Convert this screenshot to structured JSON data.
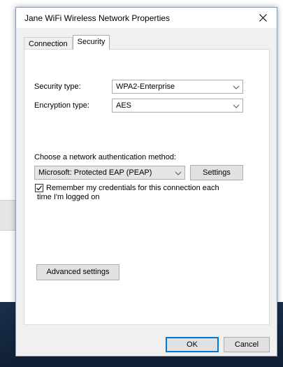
{
  "dialog": {
    "title": "Jane WiFi Wireless Network Properties",
    "close_icon": "close-icon"
  },
  "tabs": [
    {
      "label": "Connection",
      "active": false
    },
    {
      "label": "Security",
      "active": true
    }
  ],
  "security": {
    "security_type_label": "Security type:",
    "security_type_value": "WPA2-Enterprise",
    "encryption_type_label": "Encryption type:",
    "encryption_type_value": "AES",
    "auth_method_label": "Choose a network authentication method:",
    "auth_method_value": "Microsoft: Protected EAP (PEAP)",
    "settings_label": "Settings",
    "remember_line1": "Remember my credentials for this connection each",
    "remember_line2": "time I'm logged on",
    "remember_checked": true,
    "advanced_label": "Advanced settings"
  },
  "footer": {
    "ok_label": "OK",
    "cancel_label": "Cancel"
  },
  "colors": {
    "accent": "#0078d7",
    "button_bg": "#e1e1e1",
    "dialog_bg": "#f0f0f0"
  }
}
